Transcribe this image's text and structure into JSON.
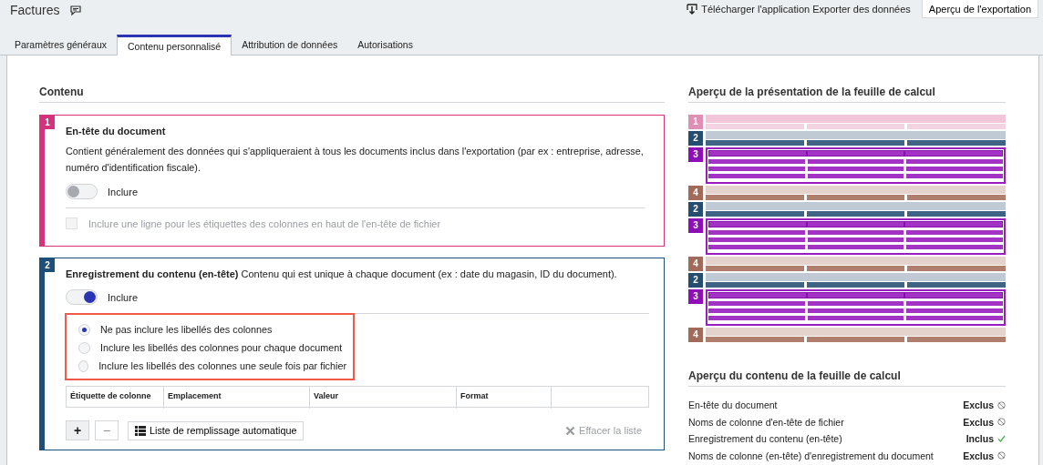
{
  "header": {
    "title": "Factures",
    "download_link": "Télécharger l'application Exporter des données",
    "preview_button": "Aperçu de l'exportation"
  },
  "tabs": [
    {
      "label": "Paramètres généraux",
      "selected": false
    },
    {
      "label": "Contenu personnalisé",
      "selected": true
    },
    {
      "label": "Attribution de données",
      "selected": false
    },
    {
      "label": "Autorisations",
      "selected": false
    }
  ],
  "content": {
    "heading": "Contenu",
    "sections": [
      {
        "number": "1",
        "color": "#d6317d",
        "title": "En-tête du document",
        "description": "Contient généralement des données qui s'appliqueraient à tous les documents inclus dans l'exportation (par ex : entreprise, adresse, numéro d'identification fiscale).",
        "toggle": {
          "label": "Inclure",
          "on": false
        },
        "checkbox": {
          "label": "Inclure une ligne pour les étiquettes des colonnes en haut de l'en-tête de fichier",
          "checked": false,
          "disabled": true
        }
      },
      {
        "number": "2",
        "color": "#1f4e79",
        "title": "**Enregistrement du contenu (en-tête)** Contenu qui est unique à chaque document (ex : date du magasin, ID du document).",
        "toggle": {
          "label": "Inclure",
          "on": true
        },
        "radio_highlight": true,
        "radios": [
          {
            "label": "Ne pas inclure les libellés des colonnes",
            "selected": true
          },
          {
            "label": "Inclure les libellés des colonnes pour chaque document",
            "selected": false
          },
          {
            "label": "Inclure les libellés des colonnes une seule fois par fichier",
            "selected": false
          }
        ],
        "table": {
          "columns": [
            "Étiquette de colonne",
            "Emplacement",
            "Valeur",
            "Format"
          ]
        },
        "buttons": [
          {
            "label": "+",
            "kind": "add"
          },
          {
            "label": "−",
            "kind": "remove"
          },
          {
            "label": "Liste de remplissage automatique",
            "kind": "list"
          }
        ],
        "clear_button": {
          "label": "Effacer la liste",
          "disabled": true
        }
      }
    ]
  },
  "layout_preview": {
    "heading": "Aperçu de la présentation de la feuille de calcul",
    "blocks": [
      {
        "label": "1",
        "kind": "file_header"
      },
      {
        "label": "2",
        "kind": "record_header"
      },
      {
        "label": "3",
        "kind": "detail"
      },
      {
        "label": "4",
        "kind": "footer"
      },
      {
        "label": "2",
        "kind": "record_header"
      },
      {
        "label": "3",
        "kind": "detail"
      },
      {
        "label": "4",
        "kind": "footer"
      },
      {
        "label": "2",
        "kind": "record_header"
      },
      {
        "label": "3",
        "kind": "detail"
      },
      {
        "label": "4",
        "kind": "footer"
      }
    ]
  },
  "content_preview": {
    "heading": "Aperçu du contenu de la feuille de calcul",
    "items": [
      {
        "label": "En-tête du document",
        "status": "Exclus",
        "included": false
      },
      {
        "label": "Noms de colonne d'en-tête de fichier",
        "status": "Exclus",
        "included": false
      },
      {
        "label": "Enregistrement du contenu (en-tête)",
        "status": "Inclus",
        "included": true
      },
      {
        "label": "Noms de colonne (en-tête) d'enregistrement du document",
        "status": "Exclus",
        "included": false
      }
    ]
  }
}
